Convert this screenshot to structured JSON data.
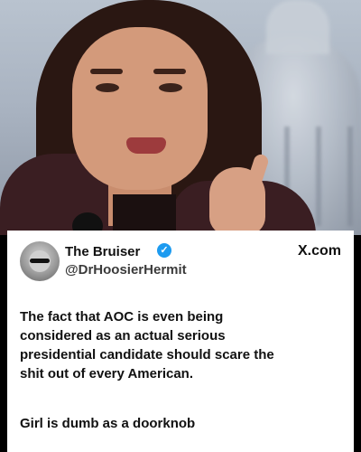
{
  "tweet": {
    "display_name": "The Bruiser",
    "verified_glyph": "✓",
    "handle": "@DrHoosierHermit",
    "brand": "X.com",
    "text_lines": [
      "The fact that AOC is even being",
      "considered as an actual serious",
      "presidential candidate should scare the",
      "shit out of every American."
    ],
    "followup": "Girl is dumb as a doorknob"
  },
  "icons": {
    "verified": "verified-badge-icon",
    "avatar": "user-avatar-icon"
  },
  "colors": {
    "verified_blue": "#1d9bf0",
    "card_bg": "#ffffff",
    "text": "#111111"
  }
}
